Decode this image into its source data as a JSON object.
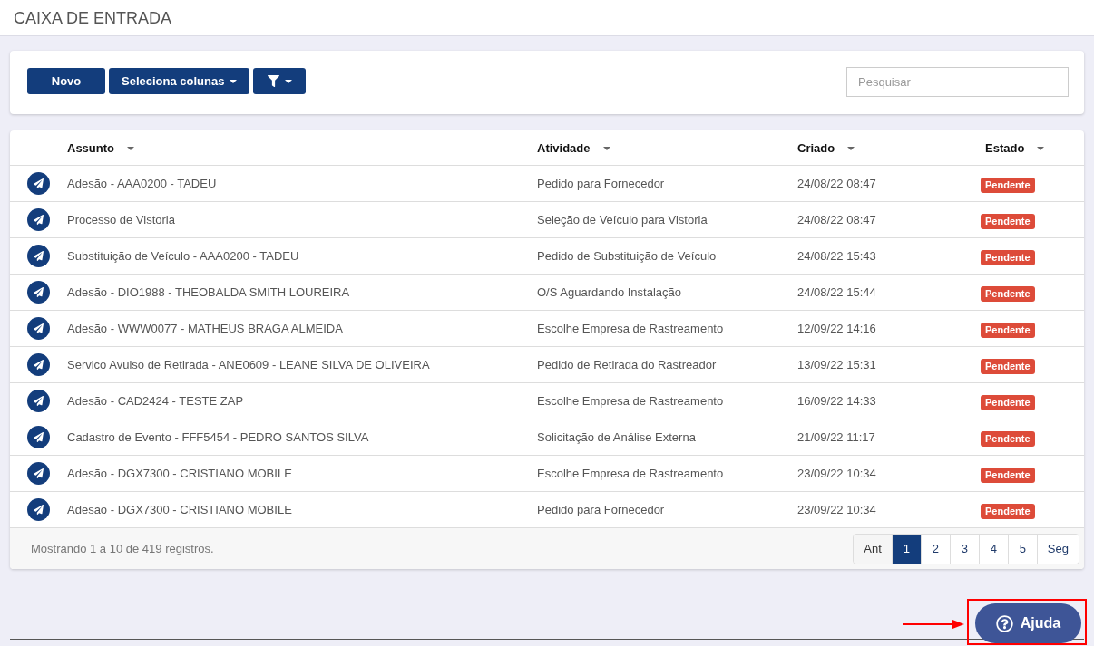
{
  "page": {
    "title": "CAIXA DE ENTRADA"
  },
  "toolbar": {
    "buttons": [
      {
        "kind": "text",
        "label": "Novo"
      },
      {
        "kind": "dropdown",
        "label": "Seleciona colunas"
      },
      {
        "kind": "filter"
      }
    ],
    "search": {
      "placeholder": "Pesquisar"
    }
  },
  "table": {
    "columns": [
      {
        "label": "Assunto"
      },
      {
        "label": "Atividade"
      },
      {
        "label": "Criado"
      },
      {
        "label": "Estado"
      }
    ],
    "rows": [
      {
        "assunto": "Adesão - AAA0200 - TADEU",
        "atividade": "Pedido para Fornecedor",
        "criado": "24/08/22 08:47",
        "estado": "Pendente"
      },
      {
        "assunto": "Processo de Vistoria",
        "atividade": "Seleção de Veículo para Vistoria",
        "criado": "24/08/22 08:47",
        "estado": "Pendente"
      },
      {
        "assunto": "Substituição de Veículo - AAA0200 - TADEU",
        "atividade": "Pedido de Substituição de Veículo",
        "criado": "24/08/22 15:43",
        "estado": "Pendente"
      },
      {
        "assunto": "Adesão - DIO1988 - THEOBALDA SMITH LOUREIRA",
        "atividade": "O/S Aguardando Instalação",
        "criado": "24/08/22 15:44",
        "estado": "Pendente"
      },
      {
        "assunto": "Adesão - WWW0077 - MATHEUS BRAGA ALMEIDA",
        "atividade": "Escolhe Empresa de Rastreamento",
        "criado": "12/09/22 14:16",
        "estado": "Pendente"
      },
      {
        "assunto": "Servico Avulso de Retirada - ANE0609 - LEANE SILVA DE OLIVEIRA",
        "atividade": "Pedido de Retirada do Rastreador",
        "criado": "13/09/22 15:31",
        "estado": "Pendente"
      },
      {
        "assunto": "Adesão - CAD2424 - TESTE ZAP",
        "atividade": "Escolhe Empresa de Rastreamento",
        "criado": "16/09/22 14:33",
        "estado": "Pendente"
      },
      {
        "assunto": "Cadastro de Evento - FFF5454 - PEDRO SANTOS SILVA",
        "atividade": "Solicitação de Análise Externa",
        "criado": "21/09/22 11:17",
        "estado": "Pendente"
      },
      {
        "assunto": "Adesão - DGX7300 - CRISTIANO MOBILE",
        "atividade": "Escolhe Empresa de Rastreamento",
        "criado": "23/09/22 10:34",
        "estado": "Pendente"
      },
      {
        "assunto": "Adesão - DGX7300 - CRISTIANO MOBILE",
        "atividade": "Pedido para Fornecedor",
        "criado": "23/09/22 10:34",
        "estado": "Pendente"
      }
    ],
    "summary": "Mostrando 1 a 10 de 419 registros.",
    "pagination": [
      {
        "label": "Ant",
        "selected": false,
        "disabled": true
      },
      {
        "label": "1",
        "selected": true,
        "disabled": false
      },
      {
        "label": "2",
        "selected": false,
        "disabled": false
      },
      {
        "label": "3",
        "selected": false,
        "disabled": false
      },
      {
        "label": "4",
        "selected": false,
        "disabled": false
      },
      {
        "label": "5",
        "selected": false,
        "disabled": false
      },
      {
        "label": "Seg",
        "selected": false,
        "disabled": false
      }
    ]
  },
  "help_button": {
    "label": "Ajuda"
  }
}
